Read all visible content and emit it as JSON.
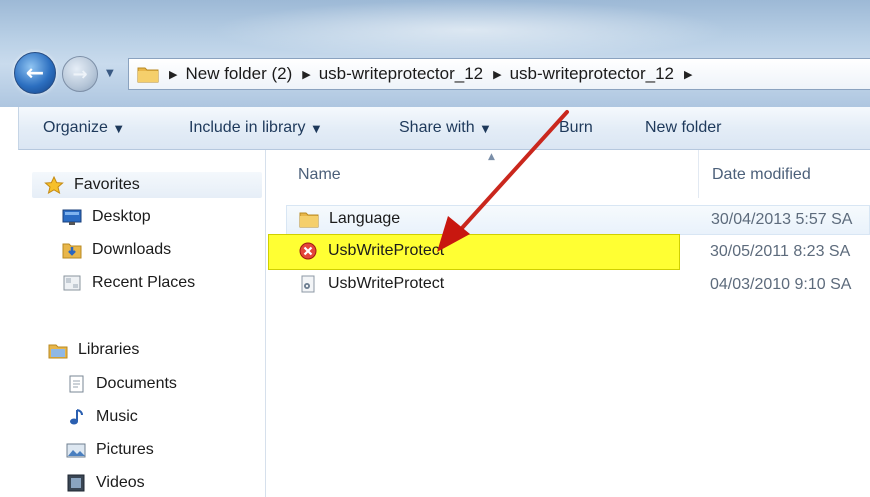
{
  "address": {
    "crumbs": [
      "New folder (2)",
      "usb-writeprotector_12",
      "usb-writeprotector_12"
    ]
  },
  "toolbar": {
    "organize": "Organize",
    "include_in_library": "Include in library",
    "share_with": "Share with",
    "burn": "Burn",
    "new_folder": "New folder"
  },
  "nav": {
    "favorites": {
      "label": "Favorites",
      "icon": "star-icon"
    },
    "favorite_items": [
      {
        "label": "Desktop",
        "icon": "desktop-icon"
      },
      {
        "label": "Downloads",
        "icon": "downloads-icon"
      },
      {
        "label": "Recent Places",
        "icon": "recent-places-icon"
      }
    ],
    "libraries": {
      "label": "Libraries",
      "icon": "libraries-icon"
    },
    "library_items": [
      {
        "label": "Documents",
        "icon": "documents-icon"
      },
      {
        "label": "Music",
        "icon": "music-icon"
      },
      {
        "label": "Pictures",
        "icon": "pictures-icon"
      },
      {
        "label": "Videos",
        "icon": "videos-icon"
      }
    ]
  },
  "columns": {
    "name": "Name",
    "date_modified": "Date modified"
  },
  "files": [
    {
      "name": "Language",
      "date": "30/04/2013 5:57 SA",
      "icon": "folder-icon"
    },
    {
      "name": "UsbWriteProtect",
      "date": "30/05/2011 8:23 SA",
      "icon": "error-app-icon",
      "highlighted": true
    },
    {
      "name": "UsbWriteProtect",
      "date": "04/03/2010 9:10 SA",
      "icon": "config-file-icon"
    }
  ],
  "colors": {
    "highlight": "#ffff33",
    "arrow": "#d11f1f",
    "accent": "#1e395b"
  }
}
